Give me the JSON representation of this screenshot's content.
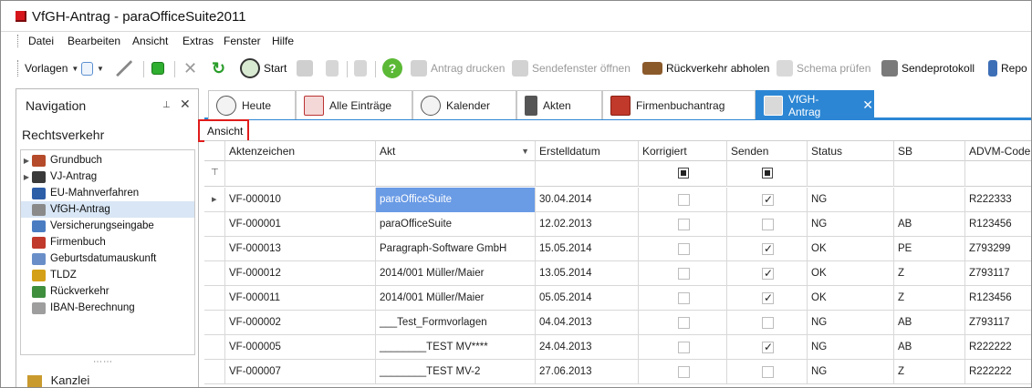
{
  "window": {
    "title": "VfGH-Antrag - paraOfficeSuite2011"
  },
  "menu": [
    "Datei",
    "Bearbeiten",
    "Ansicht",
    "Extras",
    "Fenster",
    "Hilfe"
  ],
  "toolbar": {
    "vorlagen": "Vorlagen",
    "start": "Start",
    "antrag_drucken": "Antrag drucken",
    "sendefenster": "Sendefenster öffnen",
    "rueckverkehr": "Rückverkehr abholen",
    "schema": "Schema prüfen",
    "sendeprotokoll": "Sendeprotokoll",
    "repo": "Repo"
  },
  "navigation": {
    "title": "Navigation",
    "group": "Rechtsverkehr",
    "items": [
      {
        "label": "Grundbuch",
        "expandable": true
      },
      {
        "label": "VJ-Antrag",
        "expandable": true
      },
      {
        "label": "EU-Mahnverfahren",
        "expandable": false
      },
      {
        "label": "VfGH-Antrag",
        "expandable": false,
        "selected": true
      },
      {
        "label": "Versicherungseingabe",
        "expandable": false
      },
      {
        "label": "Firmenbuch",
        "expandable": false
      },
      {
        "label": "Geburtsdatumauskunft",
        "expandable": false
      },
      {
        "label": "TLDZ",
        "expandable": false
      },
      {
        "label": "Rückverkehr",
        "expandable": false
      },
      {
        "label": "IBAN-Berechnung",
        "expandable": false
      }
    ],
    "bottom_label": "Kanzlei"
  },
  "tabs": [
    {
      "label": "Heute"
    },
    {
      "label": "Alle Einträge"
    },
    {
      "label": "Kalender"
    },
    {
      "label": "Akten"
    },
    {
      "label": "Firmenbuchantrag"
    },
    {
      "label": "VfGH-Antrag",
      "active": true
    }
  ],
  "view_label": "Ansicht",
  "grid": {
    "columns": [
      "Aktenzeichen",
      "Akt",
      "Erstelldatum",
      "Korrigiert",
      "Senden",
      "Status",
      "SB",
      "ADVM-Code"
    ],
    "rows": [
      {
        "aktenzeichen": "VF-000010",
        "akt": "paraOfficeSuite",
        "datum": "30.04.2014",
        "korrigiert": false,
        "senden": true,
        "status": "NG",
        "sb": "",
        "advm": "R222333",
        "current": true
      },
      {
        "aktenzeichen": "VF-000001",
        "akt": "paraOfficeSuite",
        "datum": "12.02.2013",
        "korrigiert": false,
        "senden": false,
        "status": "NG",
        "sb": "AB",
        "advm": "R123456"
      },
      {
        "aktenzeichen": "VF-000013",
        "akt": "Paragraph-Software GmbH",
        "datum": "15.05.2014",
        "korrigiert": false,
        "senden": true,
        "status": "OK",
        "sb": "PE",
        "advm": "Z793299"
      },
      {
        "aktenzeichen": "VF-000012",
        "akt": "2014/001 Müller/Maier",
        "datum": "13.05.2014",
        "korrigiert": false,
        "senden": true,
        "status": "OK",
        "sb": "Z",
        "advm": "Z793117"
      },
      {
        "aktenzeichen": "VF-000011",
        "akt": "2014/001 Müller/Maier",
        "datum": "05.05.2014",
        "korrigiert": false,
        "senden": true,
        "status": "OK",
        "sb": "Z",
        "advm": "R123456"
      },
      {
        "aktenzeichen": "VF-000002",
        "akt": "___Test_Formvorlagen",
        "datum": "04.04.2013",
        "korrigiert": false,
        "senden": false,
        "status": "NG",
        "sb": "AB",
        "advm": "Z793117"
      },
      {
        "aktenzeichen": "VF-000005",
        "akt": "________TEST MV****",
        "datum": "24.04.2013",
        "korrigiert": false,
        "senden": true,
        "status": "NG",
        "sb": "AB",
        "advm": "R222222"
      },
      {
        "aktenzeichen": "VF-000007",
        "akt": "________TEST MV-2",
        "datum": "27.06.2013",
        "korrigiert": false,
        "senden": false,
        "status": "NG",
        "sb": "Z",
        "advm": "R222222"
      }
    ]
  },
  "colors": {
    "accent": "#2c86d4",
    "selection": "#6a9be5",
    "brand": "#d6151b"
  }
}
